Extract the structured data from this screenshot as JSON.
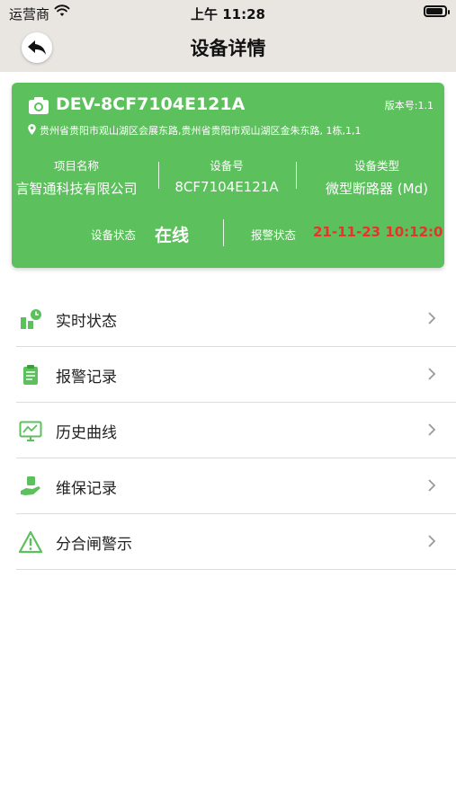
{
  "status_bar": {
    "carrier": "运营商",
    "time": "上午 11:28"
  },
  "nav": {
    "title": "设备详情"
  },
  "device": {
    "name": "DEV-8CF7104E121A",
    "version": "版本号:1.1",
    "address": "贵州省贵阳市观山湖区会展东路,贵州省贵阳市观山湖区金朱东路, 1栋,1,1",
    "project_label": "项目名称",
    "project_value": "言智通科技有限公司",
    "device_no_label": "设备号",
    "device_no_value": "8CF7104E121A",
    "device_type_label": "设备类型",
    "device_type_value": "微型断路器 (Md)",
    "state_label": "设备状态",
    "state_value": "在线",
    "alarm_label": "报警状态",
    "alarm_value": "21-11-23 10:12:0"
  },
  "menu": [
    {
      "label": "实时状态",
      "icon": "realtime-status-icon"
    },
    {
      "label": "报警记录",
      "icon": "clipboard-icon"
    },
    {
      "label": "历史曲线",
      "icon": "monitor-chart-icon"
    },
    {
      "label": "维保记录",
      "icon": "maintenance-hand-icon"
    },
    {
      "label": "分合闸警示",
      "icon": "warning-triangle-icon"
    }
  ],
  "colors": {
    "accent": "#5cc05c",
    "alarm": "#e8332a",
    "nav_bg": "#e9e6e2"
  }
}
